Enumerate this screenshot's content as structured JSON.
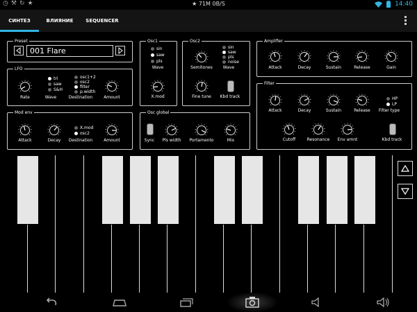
{
  "status": {
    "left_icons": [
      "clock-icon",
      "wrench-icon",
      "sync-icon",
      "star-icon"
    ],
    "center": "★ 71M 0B/S",
    "clock": "14:40",
    "right_icons": [
      "wifi-icon",
      "battery-icon"
    ]
  },
  "tabs": [
    {
      "label": "СИНТЕЗ",
      "active": true
    },
    {
      "label": "ВЛИЯНИЕ",
      "active": false
    },
    {
      "label": "SEQUENCER",
      "active": false
    }
  ],
  "preset": {
    "title": "Preset",
    "value": "001 Flare"
  },
  "lfo": {
    "title": "LFO",
    "rate_label": "Rate",
    "wave_label": "Wave",
    "destination_label": "Destination",
    "amount_label": "Amount",
    "waves": [
      "tri",
      "saw",
      "S&H"
    ],
    "destinations": [
      "osc1+2",
      "osc2",
      "filter",
      "p.width"
    ],
    "selected_wave": "tri",
    "selected_destination": "filter"
  },
  "mod_env": {
    "title": "Mod env",
    "attack_label": "Attack",
    "decay_label": "Decay",
    "destination_label": "Destination",
    "amount_label": "Amount",
    "destinations": [
      "X.mod",
      "osc2"
    ],
    "selected_destination": "osc2"
  },
  "osc1": {
    "title": "Osc1",
    "waves": [
      "sin",
      "saw",
      "pls"
    ],
    "selected_wave": "saw",
    "wave_label": "Wave",
    "xmod_label": "X.mod"
  },
  "osc2": {
    "title": "Osc2",
    "semitones_label": "Semitones",
    "wave_label": "Wave",
    "waves": [
      "sin",
      "saw",
      "pls",
      "noise"
    ],
    "selected_wave": "saw",
    "fine_tune_label": "Fine tune",
    "kbd_track_label": "Kbd track"
  },
  "osc_global": {
    "title": "Osc global",
    "sync_label": "Sync",
    "pls_width_label": "Pls width",
    "portamento_label": "Portamento",
    "mix_label": "Mix"
  },
  "amplifier": {
    "title": "Amplifier",
    "attack_label": "Attack",
    "decay_label": "Decay",
    "sustain_label": "Sustain",
    "release_label": "Release",
    "gain_label": "Gain"
  },
  "filter": {
    "title": "Filter",
    "attack_label": "Attack",
    "decay_label": "Decay",
    "sustain_label": "Sustain",
    "release_label": "Release",
    "filter_type_label": "Filter type",
    "types": [
      "HP",
      "LP"
    ],
    "selected_type": "LP",
    "cutoff_label": "Cutoff",
    "resonance_label": "Resonance",
    "env_amnt_label": "Env amnt",
    "kbd_track_label": "Kbd track"
  },
  "keyboard": {
    "white_keys": 14,
    "octave_up_icon": "triangle-up-icon",
    "octave_down_icon": "triangle-down-icon"
  },
  "navbar": {
    "icons": [
      "back-icon",
      "home-icon",
      "recent-apps-icon",
      "screenshot-icon",
      "volume-down-icon",
      "volume-up-icon"
    ]
  },
  "colors": {
    "accent": "#33b5e5",
    "background": "#000000",
    "panel_border": "#cfcfcf",
    "key_black": "#e6e6e6"
  }
}
